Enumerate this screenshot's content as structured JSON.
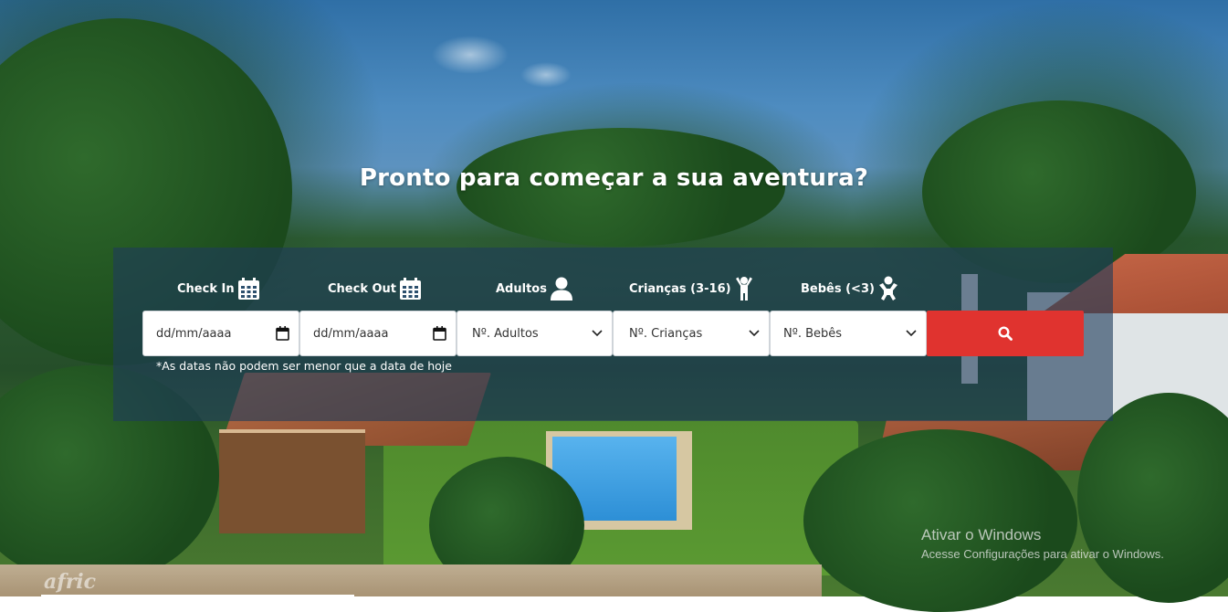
{
  "hero": {
    "title": "Pronto para começar a sua aventura?"
  },
  "booking_form": {
    "checkin": {
      "label": "Check In",
      "icon": "calendar-icon",
      "placeholder": "dd/mm/aaaa"
    },
    "checkout": {
      "label": "Check Out",
      "icon": "calendar-icon",
      "placeholder": "dd/mm/aaaa"
    },
    "adults": {
      "label": "Adultos",
      "icon": "user-icon",
      "selected": "Nº. Adultos"
    },
    "children": {
      "label": "Crianças (3-16)",
      "icon": "child-icon",
      "selected": "Nº. Crianças"
    },
    "babies": {
      "label": "Bebês (<3)",
      "icon": "baby-icon",
      "selected": "Nº. Bebês"
    },
    "search_icon": "search-icon",
    "date_note": "*As datas não podem ser menor que a data de hoje"
  },
  "logo": {
    "text": "afric"
  },
  "windows_watermark": {
    "title": "Ativar o Windows",
    "subtitle": "Acesse Configurações para ativar o Windows."
  },
  "colors": {
    "search_button": "#e0332f",
    "panel_overlay": "rgba(30,60,90,0.62)",
    "text_light": "#ffffff"
  }
}
